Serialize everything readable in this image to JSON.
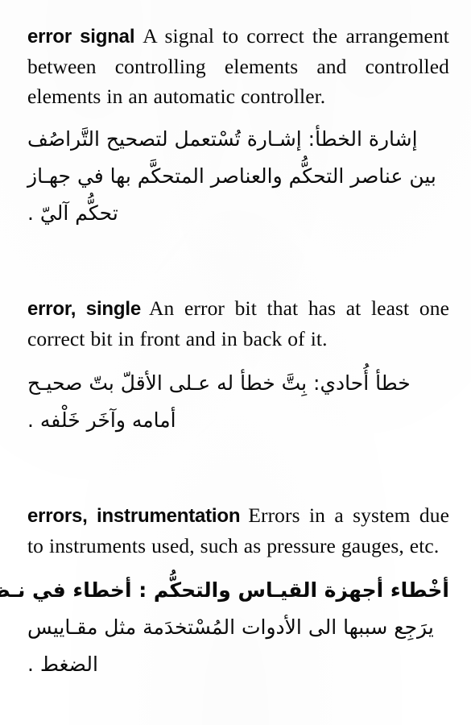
{
  "page": {
    "type": "scanned-dictionary-page",
    "language_pair": "English-Arabic",
    "background_color": "#ffffff",
    "text_color": "#0a0a0a"
  },
  "entries": [
    {
      "headword": "error signal",
      "definition": "A signal to correct the arrangement between controlling elements and controlled elements in an automatic controller.",
      "arabic_headword": "إشارة الخطأ:",
      "arabic_lines": [
        "إشارة الخطأ: إشـارة تُسْتعمل لتصحيح التَّراصُف",
        "بين عناصر التحكُّم والعناصر المتحكَّم بها في جهـاز",
        "تحكُّم آليّ ."
      ],
      "arabic_headword_bold": false
    },
    {
      "headword": "error, single",
      "definition": "An error bit that has at least one correct bit in front and in back of it.",
      "arabic_headword": "خطأ أُحادي:",
      "arabic_lines": [
        "خطأ أُحادي: بِتَّ خطأ له عـلى الأقلّ بتّ صحيـح",
        "أمامه وآخَر خَلْفه ."
      ],
      "arabic_headword_bold": false
    },
    {
      "headword": "errors, instrumentation",
      "definition": "Errors in a system due to instruments used, such as pressure gauges, etc.",
      "arabic_headword": "أخْطاء أجهزة القيـاس والتحكُّم:",
      "arabic_lines": [
        "أخْطاء أجهزة القيـاس والتحكُّم : أخطاء في نـظام",
        "يرَجِع سببها الى الأدوات المُسْتخدَمة مثل مقـاييس",
        "الضغط ."
      ],
      "arabic_headword_bold": true
    }
  ]
}
